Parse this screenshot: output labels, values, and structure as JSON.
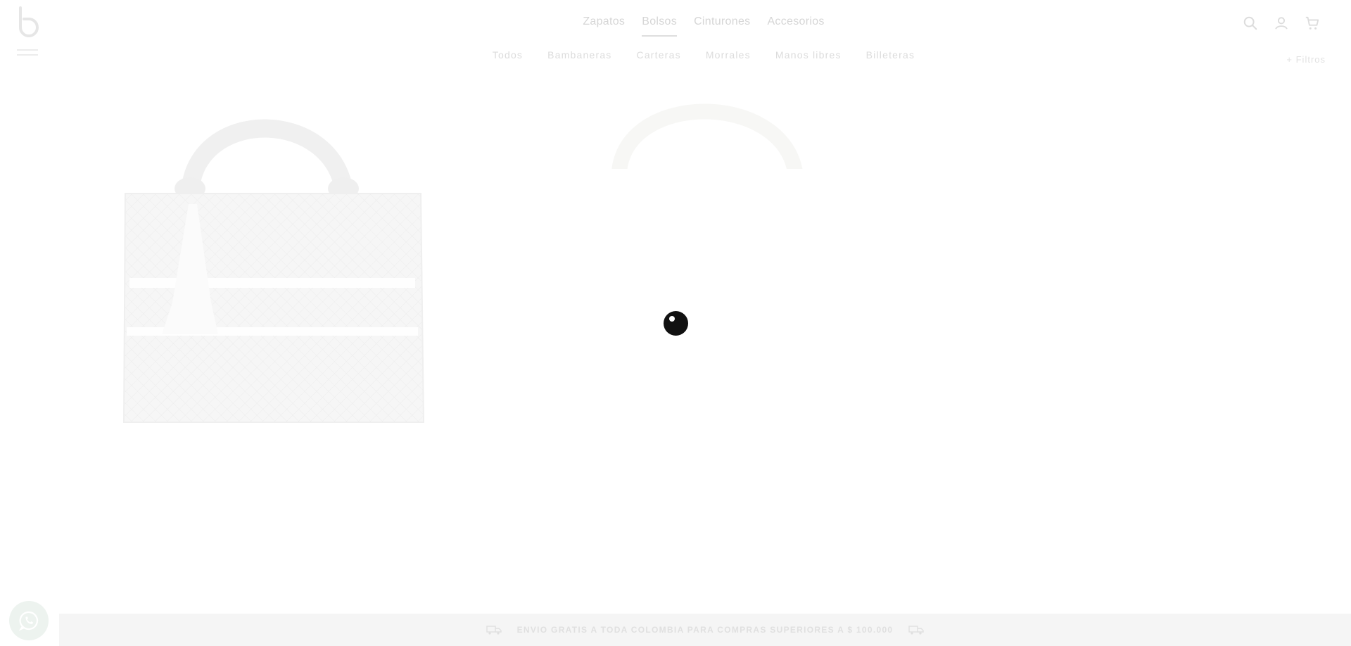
{
  "header": {
    "main_nav": [
      {
        "label": "Zapatos",
        "active": false
      },
      {
        "label": "Bolsos",
        "active": true
      },
      {
        "label": "Cinturones",
        "active": false
      },
      {
        "label": "Accesorios",
        "active": false
      }
    ],
    "sub_nav": [
      {
        "label": "Todos"
      },
      {
        "label": "Bambaneras"
      },
      {
        "label": "Carteras"
      },
      {
        "label": "Morrales"
      },
      {
        "label": "Manos libres"
      },
      {
        "label": "Billeteras"
      }
    ],
    "icons": [
      "search-icon",
      "user-icon",
      "cart-icon"
    ],
    "filter_label": "+ Filtros"
  },
  "promo": {
    "text": "ENVIO GRATIS A TODA COLOMBIA PARA COMPRAS SUPERIORES A $ 100.000"
  },
  "colors": {
    "loader": "#111111",
    "faded_text": "#d6d6d6",
    "promo_bg": "#f5f5f5"
  }
}
